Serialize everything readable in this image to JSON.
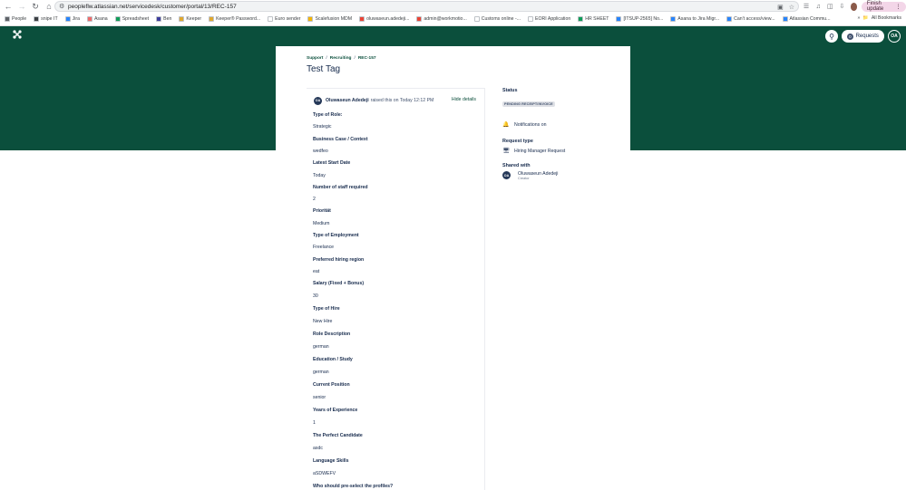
{
  "browser": {
    "url": "peopleflw.atlassian.net/servicedesk/customer/portal/13/REC-157",
    "finish_update": "Finish update",
    "all_bookmarks": "All Bookmarks",
    "bookmarks": [
      {
        "label": "People",
        "color": "#5f6368"
      },
      {
        "label": "snipe IT",
        "color": "#3c4043"
      },
      {
        "label": "Jira",
        "color": "#2684ff"
      },
      {
        "label": "Asana",
        "color": "#f06a6a"
      },
      {
        "label": "Spreadsheet",
        "color": "#0f9d58"
      },
      {
        "label": "Ben",
        "color": "#3d3d9e"
      },
      {
        "label": "Keeper",
        "color": "#e0a82e"
      },
      {
        "label": "Keeper® Password...",
        "color": "#e0a82e"
      },
      {
        "label": "Euro sender",
        "color": "#ffffff"
      },
      {
        "label": "Scalefusion MDM",
        "color": "#f5b400"
      },
      {
        "label": "oluwaseun.adedeji...",
        "color": "#ea4335"
      },
      {
        "label": "admin@workmotio...",
        "color": "#ea4335"
      },
      {
        "label": "Customs online -...",
        "color": "#ffffff"
      },
      {
        "label": "EORI Application",
        "color": "#ffffff"
      },
      {
        "label": "HR SHEET",
        "color": "#0f9d58"
      },
      {
        "label": "[ITSUP-2565] No...",
        "color": "#2684ff"
      },
      {
        "label": "Asana to Jira Migr...",
        "color": "#2684ff"
      },
      {
        "label": "Can't access/view...",
        "color": "#2684ff"
      },
      {
        "label": "Atlassian Commu...",
        "color": "#2684ff"
      }
    ]
  },
  "header": {
    "requests_label": "Requests",
    "requests_badge": "0",
    "avatar_initials": "OA"
  },
  "breadcrumb": [
    "Support",
    "Recruiting",
    "REC-157"
  ],
  "title": "Test Tag",
  "activity": {
    "author": "Oluwaseun Adedeji",
    "action": "raised this on Today 12:12 PM",
    "author_initials": "OA",
    "hide_details": "Hide details"
  },
  "fields": [
    {
      "label": "Type of Role:",
      "value": "Strategic"
    },
    {
      "label": "Business Case / Context",
      "value": "wedfeo"
    },
    {
      "label": "Latest Start Date",
      "value": "Today"
    },
    {
      "label": "Number of staff required",
      "value": "2"
    },
    {
      "label": "Priorität",
      "value": "Medium"
    },
    {
      "label": "Type of Employment",
      "value": "Freelance"
    },
    {
      "label": "Preferred hiring region",
      "value": "eat"
    },
    {
      "label": "Salary (Fixed + Bonus)",
      "value": "30"
    },
    {
      "label": "Type of Hire",
      "value": "New Hire"
    },
    {
      "label": "Role Description",
      "value": "german"
    },
    {
      "label": "Education / Study",
      "value": "german"
    },
    {
      "label": "Current Position",
      "value": "senior"
    },
    {
      "label": "Years of Experience",
      "value": "1"
    },
    {
      "label": "The Perfect Candidate",
      "value": "asdc"
    },
    {
      "label": "Language Skills",
      "value": "aSDWEFV"
    },
    {
      "label": "Who should pre-select the profiles?",
      "value": ""
    }
  ],
  "side": {
    "status_label": "Status",
    "status_value": "PENDING RECEIPT/INVOICE",
    "notifications": "Notifications on",
    "request_type_label": "Request type",
    "request_type_value": "Hiring Manager Request",
    "shared_label": "Shared with",
    "shared_name": "Oluwaseun Adedeji",
    "shared_role": "Creator",
    "shared_initials": "OA"
  },
  "colors": {
    "brand": "#0b4f3c",
    "text": "#172b4d"
  }
}
